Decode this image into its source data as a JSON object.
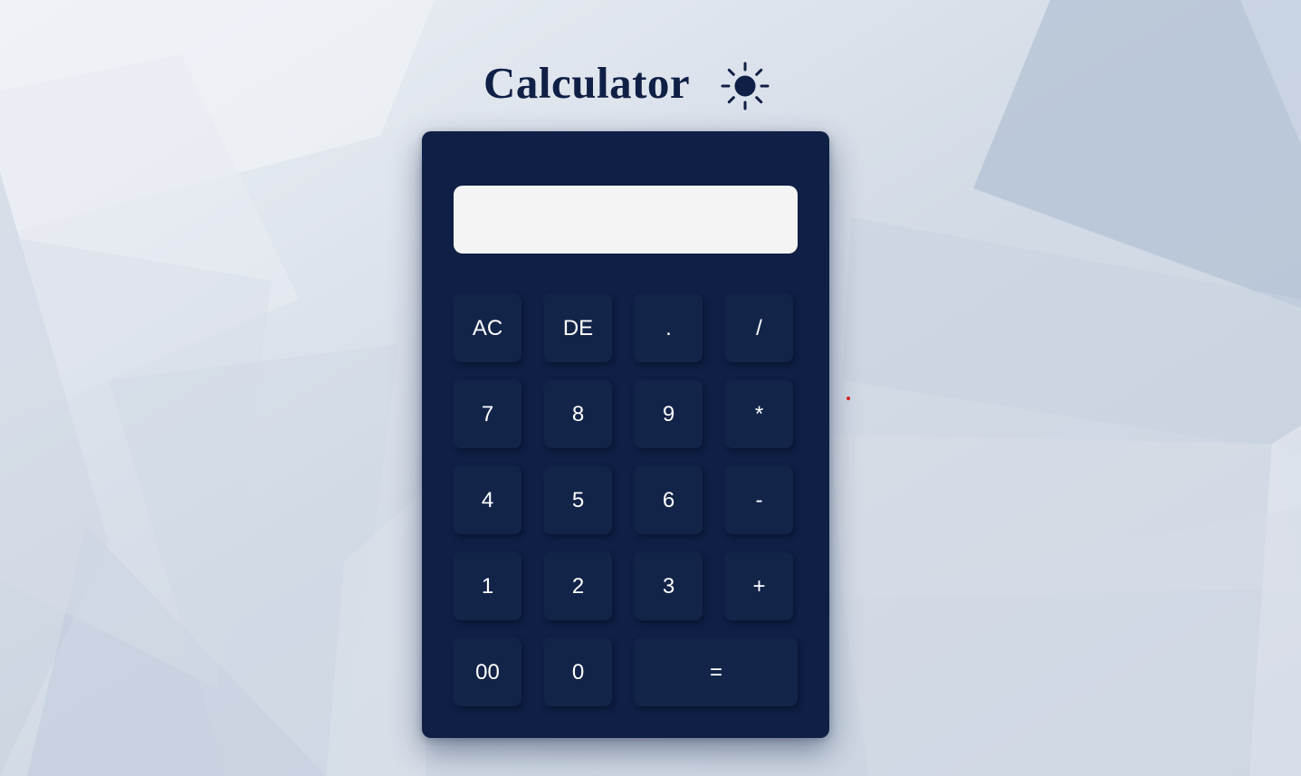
{
  "app": {
    "title": "Calculator",
    "theme_toggle_icon": "sun-icon"
  },
  "display": {
    "value": ""
  },
  "keys": [
    {
      "label": "AC"
    },
    {
      "label": "DE"
    },
    {
      "label": "."
    },
    {
      "label": "/"
    },
    {
      "label": "7"
    },
    {
      "label": "8"
    },
    {
      "label": "9"
    },
    {
      "label": "*"
    },
    {
      "label": "4"
    },
    {
      "label": "5"
    },
    {
      "label": "6"
    },
    {
      "label": "-"
    },
    {
      "label": "1"
    },
    {
      "label": "2"
    },
    {
      "label": "3"
    },
    {
      "label": "+"
    },
    {
      "label": "00"
    },
    {
      "label": "0"
    },
    {
      "label": "="
    }
  ],
  "colors": {
    "calculator_body": "#0f1f45",
    "key_background": "#132449",
    "display_background": "#f4f4f5",
    "title_text": "#101f45",
    "key_text": "#ffffff"
  }
}
